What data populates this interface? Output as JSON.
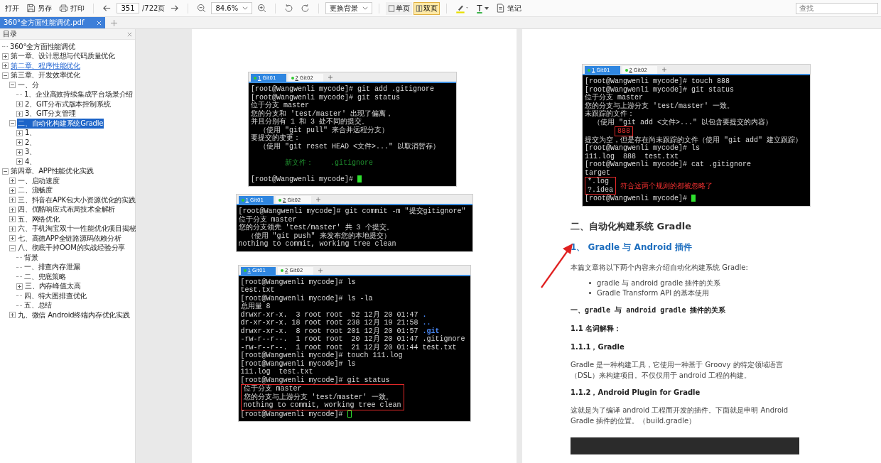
{
  "toolbar": {
    "open": "打开",
    "save": "另存",
    "print": "打印",
    "page": "351",
    "page_total": "/722页",
    "zoom": "84.6%",
    "background": "更换背景",
    "view_modes": [
      {
        "label": "单页",
        "selected": false
      },
      {
        "label": "双页",
        "selected": true
      }
    ],
    "text_color_glyph": "T",
    "note": "笔记",
    "search": {
      "placeholder": "查找"
    }
  },
  "tabs": [
    {
      "label": "360°全方面性能调优.pdf",
      "selected": true
    }
  ],
  "sidebar": {
    "title": "目录",
    "items": [
      {
        "label": "360°全方面性能调优",
        "selected": false,
        "hovered": false
      },
      {
        "label": "第一章、设计思想与代码质量优化",
        "selected": false,
        "hovered": false,
        "expanded": false
      },
      {
        "label": "第二章、程序性能优化",
        "selected": false,
        "hovered": true,
        "expanded": false
      },
      {
        "label": "第三章、开发效率优化",
        "selected": false,
        "hovered": false,
        "expanded": true,
        "children": [
          {
            "label": "一、分",
            "selected": false,
            "hovered": false,
            "expanded": true,
            "children": [
              {
                "label": "1、企业高效持续集成平台场景介绍",
                "selected": false,
                "hovered": false
              },
              {
                "label": "2、GIT分布式版本控制系统",
                "selected": false,
                "hovered": false,
                "expanded": false
              },
              {
                "label": "3、GIT分支管理",
                "selected": false,
                "hovered": false,
                "expanded": false
              }
            ]
          },
          {
            "label": "二、自动化构建系统Gradle",
            "selected": true,
            "hovered": false,
            "expanded": true,
            "children": [
              {
                "label": "1、",
                "selected": false,
                "hovered": false,
                "expanded": false
              },
              {
                "label": "2、",
                "selected": false,
                "hovered": false,
                "expanded": false
              },
              {
                "label": "3、",
                "selected": false,
                "hovered": false,
                "expanded": false
              },
              {
                "label": "4、",
                "selected": false,
                "hovered": false,
                "expanded": false
              }
            ]
          }
        ]
      },
      {
        "label": "第四章、APP性能优化实践",
        "selected": false,
        "hovered": false,
        "expanded": true,
        "children": [
          {
            "label": "一、启动速度",
            "selected": false,
            "hovered": false,
            "expanded": false
          },
          {
            "label": "二、流畅度",
            "selected": false,
            "hovered": false,
            "expanded": false
          },
          {
            "label": "三、抖音在APK包大小资源优化的实践",
            "selected": false,
            "hovered": false,
            "expanded": false
          },
          {
            "label": "四、优酷响应式布局技术全解析",
            "selected": false,
            "hovered": false,
            "expanded": false
          },
          {
            "label": "五、网络优化",
            "selected": false,
            "hovered": false,
            "expanded": false
          },
          {
            "label": "六、手机淘宝双十一性能优化项目揭秘",
            "selected": false,
            "hovered": false,
            "expanded": false
          },
          {
            "label": "七、高德APP全链路源码依赖分析",
            "selected": false,
            "hovered": false,
            "expanded": false
          },
          {
            "label": "八、彻底干掉OOM的实战经验分享",
            "selected": false,
            "hovered": false,
            "expanded": true,
            "children": [
              {
                "label": "背景",
                "selected": false,
                "hovered": false
              },
              {
                "label": "一、排查内存泄漏",
                "selected": false,
                "hovered": false
              },
              {
                "label": "二、兜底策略",
                "selected": false,
                "hovered": false
              },
              {
                "label": "三、内存峰值太高",
                "selected": false,
                "hovered": false,
                "expanded": false
              },
              {
                "label": "四、特大图排查优化",
                "selected": false,
                "hovered": false
              },
              {
                "label": "五、总结",
                "selected": false,
                "hovered": false
              }
            ]
          },
          {
            "label": "九、微信 Android终端内存优化实践",
            "selected": false,
            "hovered": false,
            "expanded": false
          }
        ]
      }
    ]
  },
  "pages": [
    {
      "terminals": [
        {
          "tabs": [
            {
              "number": "1",
              "name": "Git01",
              "selected": true
            },
            {
              "number": "2",
              "name": "Git02",
              "selected": false
            }
          ],
          "lines": [
            {
              "kind": "text",
              "text": "[root@Wangwenli mycode]# git add .gitignore"
            },
            {
              "kind": "text",
              "text": "[root@Wangwenli mycode]# git status"
            },
            {
              "kind": "text",
              "text": "位于分支 master"
            },
            {
              "kind": "text",
              "text": "您的分支和 'test/master' 出现了偏离，"
            },
            {
              "kind": "text",
              "text": "并且分别有 1 和 3 处不同的提交。"
            },
            {
              "kind": "text",
              "text": "  （使用 \"git pull\" 来合并远程分支）"
            },
            {
              "kind": "text",
              "text": "要提交的变更："
            },
            {
              "kind": "text",
              "text": "  （使用 \"git reset HEAD <文件>...\" 以取消暂存）"
            },
            {
              "kind": "blank"
            },
            {
              "kind": "staged",
              "text": "        新文件：    .gitignore"
            },
            {
              "kind": "blank"
            },
            {
              "kind": "text",
              "text": "[root@Wangwenli mycode]# ",
              "cursor": true,
              "cursor_filled": true
            }
          ]
        },
        {
          "tabs": [
            {
              "number": "1",
              "name": "Git01",
              "selected": true
            },
            {
              "number": "2",
              "name": "Git02",
              "selected": false
            }
          ],
          "lines": [
            {
              "kind": "text",
              "text": "[root@Wangwenli mycode]# git commit -m \"提交gitignore\""
            },
            {
              "kind": "text",
              "text": "位于分支 master"
            },
            {
              "kind": "text",
              "text": "您的分支领先 'test/master' 共 3 个提交。"
            },
            {
              "kind": "text",
              "text": "  （使用 \"git push\" 来发布您的本地提交）"
            },
            {
              "kind": "text",
              "text": "nothing to commit, working tree clean"
            }
          ]
        },
        {
          "tabs": [
            {
              "number": "1",
              "name": "Git01",
              "selected": true
            },
            {
              "number": "2",
              "name": "Git02",
              "selected": false
            }
          ],
          "lines": [
            {
              "kind": "text",
              "text": "[root@Wangwenli mycode]# ls"
            },
            {
              "kind": "text",
              "text": "test.txt"
            },
            {
              "kind": "text",
              "text": "[root@Wangwenli mycode]# ls -la"
            },
            {
              "kind": "text",
              "text": "总用量 8"
            },
            {
              "kind": "parts",
              "parts": [
                {
                  "kind": "plain",
                  "text": "drwxr-xr-x.  3 root root  52 12月 20 01:47 "
                },
                {
                  "kind": "directory",
                  "text": "."
                }
              ]
            },
            {
              "kind": "parts",
              "parts": [
                {
                  "kind": "plain",
                  "text": "dr-xr-xr-x. 18 root root 238 12月 19 21:58 "
                },
                {
                  "kind": "directory",
                  "text": ".."
                }
              ]
            },
            {
              "kind": "parts",
              "parts": [
                {
                  "kind": "plain",
                  "text": "drwxr-xr-x.  8 root root 201 12月 20 01:57 "
                },
                {
                  "kind": "directory",
                  "text": ".git"
                }
              ]
            },
            {
              "kind": "text",
              "text": "-rw-r--r--.  1 root root  20 12月 20 01:47 .gitignore"
            },
            {
              "kind": "text",
              "text": "-rw-r--r--.  1 root root  21 12月 20 01:44 test.txt"
            },
            {
              "kind": "text",
              "text": "[root@Wangwenli mycode]# touch 111.log"
            },
            {
              "kind": "text",
              "text": "[root@Wangwenli mycode]# ls"
            },
            {
              "kind": "text",
              "text": "111.log  test.txt"
            },
            {
              "kind": "text",
              "text": "[root@Wangwenli mycode]# git status"
            },
            {
              "kind": "group",
              "lines": [
                {
                  "kind": "plain",
                  "text": "位于分支 master"
                },
                {
                  "kind": "plain",
                  "text": "您的分支与上游分支 'test/master' 一致。"
                },
                {
                  "kind": "plain",
                  "text": "nothing to commit, working tree clean"
                }
              ]
            },
            {
              "kind": "text",
              "text": "[root@Wangwenli mycode]# ",
              "cursor": true,
              "cursor_filled": false
            }
          ]
        }
      ]
    },
    {
      "terminals": [
        {
          "tabs": [
            {
              "number": "1",
              "name": "Git01",
              "selected": true
            },
            {
              "number": "2",
              "name": "Git02",
              "selected": false
            }
          ],
          "lines": [
            {
              "kind": "text",
              "text": "[root@Wangwenli mycode]# touch 888"
            },
            {
              "kind": "text",
              "text": "[root@Wangwenli mycode]# git status"
            },
            {
              "kind": "text",
              "text": "位于分支 master"
            },
            {
              "kind": "text",
              "text": "您的分支与上游分支 'test/master' 一致。"
            },
            {
              "kind": "text",
              "text": "未跟踪的文件："
            },
            {
              "kind": "text",
              "text": "  （使用 \"git add <文件>...\" 以包含要提交的内容）"
            },
            {
              "kind": "group",
              "indent": true,
              "lines": [
                {
                  "kind": "untracked",
                  "text": "888"
                }
              ]
            },
            {
              "kind": "text",
              "text": "提交为空，但是存在尚未跟踪的文件（使用 \"git add\" 建立跟踪）"
            },
            {
              "kind": "text",
              "text": "[root@Wangwenli mycode]# ls"
            },
            {
              "kind": "text",
              "text": "111.log  888  test.txt"
            },
            {
              "kind": "text",
              "text": "[root@Wangwenli mycode]# cat .gitignore"
            },
            {
              "kind": "text",
              "text": "target"
            },
            {
              "kind": "group",
              "lines": [
                {
                  "kind": "plain",
                  "text": "*.log"
                },
                {
                  "kind": "plain",
                  "text": "?.idea"
                }
              ],
              "note": "符合这两个规则的都被忽略了"
            },
            {
              "kind": "text",
              "text": "[root@Wangwenli mycode]# ",
              "cursor": true,
              "cursor_filled": true
            }
          ]
        }
      ],
      "article": [
        {
          "kind": "h1",
          "text": "二、自动化构建系统 Gradle"
        },
        {
          "kind": "h2",
          "text": "1、 Gradle 与 Android 插件"
        },
        {
          "kind": "p",
          "text": "本篇文章将以下两个内容来介绍自动化构建系统 Gradle:"
        },
        {
          "kind": "list",
          "items": [
            "gradle  与  android gradle  插件的关系",
            "Gradle Transform API  的基本使用"
          ]
        },
        {
          "kind": "h5",
          "text": "一、gradle 与 android gradle 插件的关系"
        },
        {
          "kind": "h3",
          "text": "1.1 名词解释："
        },
        {
          "kind": "h4",
          "text": "1.1.1，Gradle"
        },
        {
          "kind": "p",
          "text": "Gradle 是一种构建工具，它使用一种基于 Groovy 的特定领域语言（DSL）来构建项目。不仅仅用于 android  工程的构建。"
        },
        {
          "kind": "h4",
          "text": "1.1.2，Android Plugin for Gradle"
        },
        {
          "kind": "p",
          "text": "这就是为了编译 android  工程而开发的插件。下面就是申明 Android Gradle  插件的位置。（build.gradle）"
        },
        {
          "kind": "code_block"
        }
      ]
    }
  ]
}
